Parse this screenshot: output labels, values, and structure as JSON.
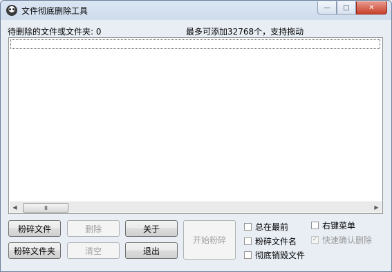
{
  "window": {
    "title": "文件彻底删除工具",
    "caption": {
      "minimize": "—",
      "maximize": "□",
      "close": "✕"
    }
  },
  "info": {
    "pending_label": "待删除的文件或文件夹: 0",
    "capacity_label": "最多可添加32768个，支持拖动"
  },
  "list": {
    "items": [],
    "scroll_left": "◀",
    "scroll_right": "▶",
    "thumb_grip": "III"
  },
  "buttons": {
    "shred_file": "粉碎文件",
    "shred_folder": "粉碎文件夹",
    "delete": "删除",
    "clear": "清空",
    "about": "关于",
    "exit": "退出",
    "start_shred": "开始粉碎"
  },
  "options": {
    "always_on_top": {
      "label": "总在最前",
      "checked": false,
      "enabled": true
    },
    "shred_filename": {
      "label": "粉碎文件名",
      "checked": false,
      "enabled": true
    },
    "destroy_file": {
      "label": "彻底销毁文件",
      "checked": false,
      "enabled": true
    },
    "context_menu": {
      "label": "右键菜单",
      "checked": false,
      "enabled": true
    },
    "quick_confirm_delete": {
      "label": "快速确认删除",
      "checked": true,
      "enabled": false
    }
  },
  "colors": {
    "window_frame": "#6b7f99",
    "close_button": "#c8402b",
    "disabled_text": "#a0a0a0"
  }
}
